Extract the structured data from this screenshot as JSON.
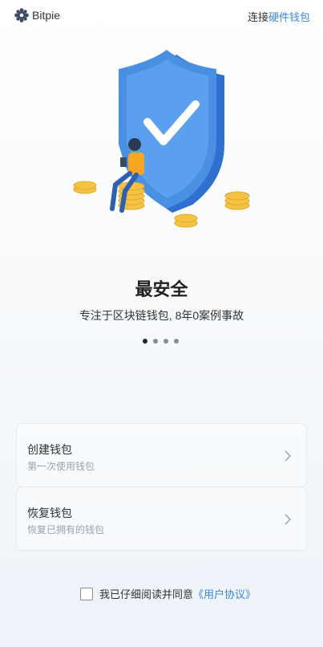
{
  "header": {
    "brand": "Bitpie",
    "connect_prefix": "连接",
    "connect_link": "硬件钱包"
  },
  "hero": {
    "illustration": "shield-check-person-coins"
  },
  "slide": {
    "title": "最安全",
    "subtitle": "专注于区块链钱包, 8年0案例事故"
  },
  "pagination": {
    "count": 4,
    "active": 1
  },
  "options": [
    {
      "title": "创建钱包",
      "subtitle": "第一次使用钱包",
      "icon": "chevron-right-icon"
    },
    {
      "title": "恢复钱包",
      "subtitle": "恢复已拥有的钱包",
      "icon": "chevron-right-icon"
    }
  ],
  "agreement": {
    "checked": false,
    "text": "我已仔细阅读并同意",
    "link": "《用户协议》"
  },
  "colors": {
    "accent": "#3a86d8",
    "shield": "#4a90e2",
    "coin": "#f5c242",
    "shirt": "#f5a623"
  }
}
